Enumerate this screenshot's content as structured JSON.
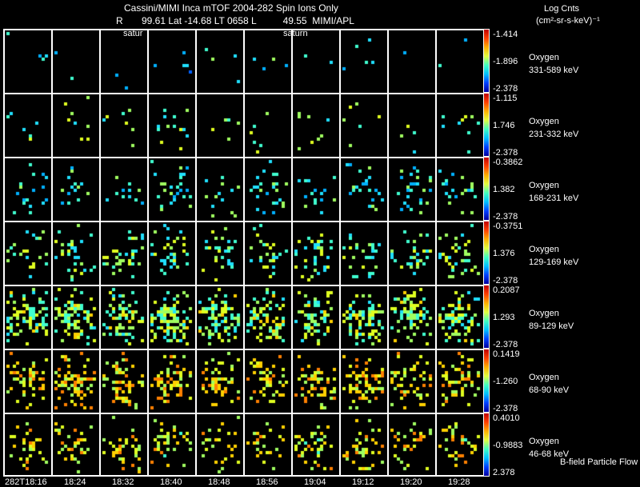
{
  "header": {
    "title": "Cassini/MIMI Inca mTOF  2004-282   Spin   Ions Only",
    "subtitle": "R       99.61 Lat -14.68 LT 0658 L          49.55  MIMI/APL",
    "label_satur": "satur",
    "label_saturn": "saturn",
    "units_title": "Log Cnts",
    "units": "(cm²-sr-s-keV)⁻¹"
  },
  "footer_label": "B-field Particle Flow",
  "chart_data": {
    "type": "heatmap",
    "title": "Cassini/MIMI Inca mTOF 2004-282 Spin Ions Only",
    "x_tick_labels": [
      "282T18:16",
      "18:24",
      "18:32",
      "18:40",
      "18:48",
      "18:56",
      "19:04",
      "19:12",
      "19:20",
      "19:28"
    ],
    "rows": [
      {
        "species": "Oxygen",
        "energy": "331-589 keV",
        "cmax": "-1.414",
        "cmid": "-1.896",
        "cmin": "-2.378",
        "density": 0.008,
        "level": 0.3
      },
      {
        "species": "Oxygen",
        "energy": "231-332 keV",
        "cmax": "-1.115",
        "cmid": "1.746",
        "cmin": "-2.378",
        "density": 0.02,
        "level": 0.45
      },
      {
        "species": "Oxygen",
        "energy": "168-231 keV",
        "cmax": "-0.3862",
        "cmid": "1.382",
        "cmin": "-2.378",
        "density": 0.06,
        "level": 0.35
      },
      {
        "species": "Oxygen",
        "energy": "129-169 keV",
        "cmax": "-0.3751",
        "cmid": "1.376",
        "cmin": "-2.378",
        "density": 0.09,
        "level": 0.45
      },
      {
        "species": "Oxygen",
        "energy": "89-129 keV",
        "cmax": "0.2087",
        "cmid": "1.293",
        "cmin": "-2.378",
        "density": 0.2,
        "level": 0.5
      },
      {
        "species": "Oxygen",
        "energy": "68-90 keV",
        "cmax": "0.1419",
        "cmid": "-1.260",
        "cmin": "-2.378",
        "density": 0.16,
        "level": 0.65
      },
      {
        "species": "Oxygen",
        "energy": "46-68 keV",
        "cmax": "0.4010",
        "cmid": "-0.9883",
        "cmin": "2.378",
        "density": 0.1,
        "level": 0.62
      }
    ]
  }
}
